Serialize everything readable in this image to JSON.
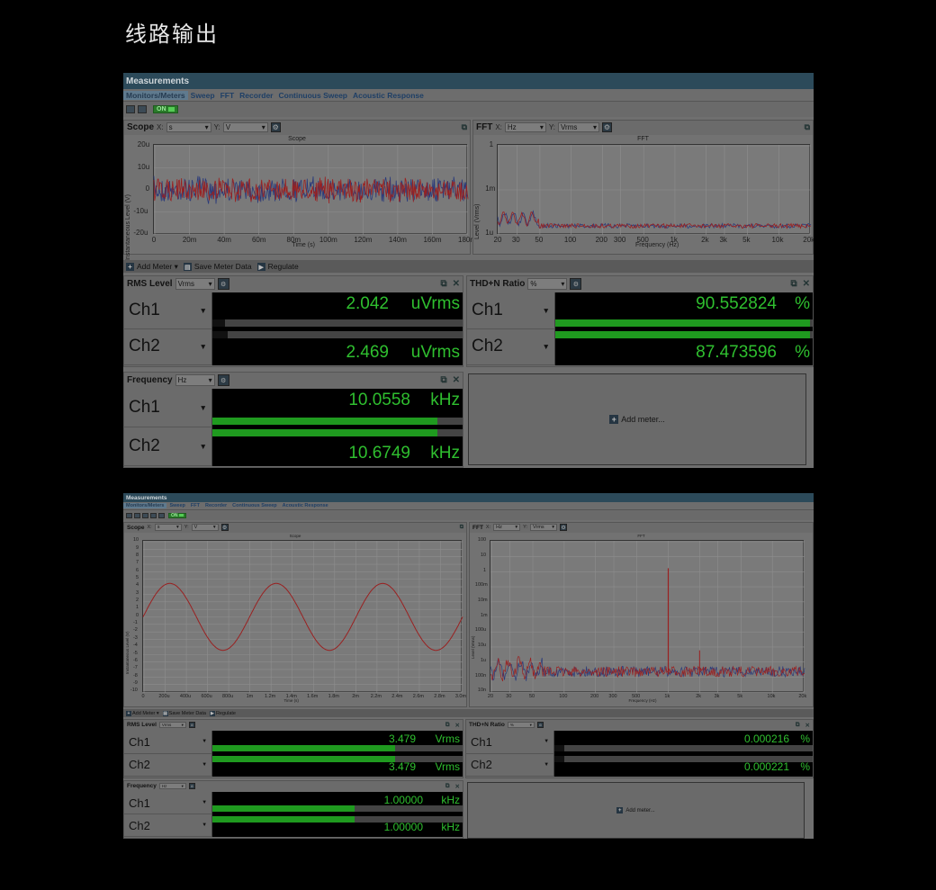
{
  "page_title": "线路输出",
  "window_title": "Measurements",
  "tabs": [
    "Monitors/Meters",
    "Sweep",
    "FFT",
    "Recorder",
    "Continuous Sweep",
    "Acoustic Response"
  ],
  "toolbar": {
    "on_label": "ON"
  },
  "meter_toolbar": {
    "add_meter": "Add Meter",
    "save_meter_data": "Save Meter Data",
    "regulate": "Regulate"
  },
  "add_meter_label": "Add meter...",
  "s1": {
    "scope": {
      "name": "Scope",
      "x_label": "X:",
      "x_unit": "s",
      "y_label": "Y:",
      "y_unit": "V",
      "plot_title": "Scope",
      "xticks": [
        "0",
        "20m",
        "40m",
        "60m",
        "80m",
        "100m",
        "120m",
        "140m",
        "160m",
        "180m"
      ],
      "yticks": [
        "20u",
        "10u",
        "0",
        "-10u",
        "-20u"
      ],
      "xlabel": "Time (s)",
      "ylabel": "Instantaneous Level (V)"
    },
    "fft": {
      "name": "FFT",
      "x_label": "X:",
      "x_unit": "Hz",
      "y_label": "Y:",
      "y_unit": "Vrms",
      "plot_title": "FFT",
      "xticks": [
        "20",
        "30",
        "50",
        "100",
        "200",
        "300",
        "500",
        "1k",
        "2k",
        "3k",
        "5k",
        "10k",
        "20k"
      ],
      "yticks": [
        "1",
        "1m",
        "1u"
      ],
      "xlabel": "Frequency (Hz)",
      "ylabel": "Level (Vrms)"
    },
    "rms": {
      "name": "RMS Level",
      "unit_sel": "Vrms",
      "ch1": {
        "name": "Ch1",
        "value": "2.042",
        "unit": "uVrms",
        "bar": 0.05
      },
      "ch2": {
        "name": "Ch2",
        "value": "2.469",
        "unit": "uVrms",
        "bar": 0.06
      }
    },
    "thdn": {
      "name": "THD+N Ratio",
      "unit_sel": "%",
      "ch1": {
        "name": "Ch1",
        "value": "90.552824",
        "unit": "%",
        "bar": 0.99
      },
      "ch2": {
        "name": "Ch2",
        "value": "87.473596",
        "unit": "%",
        "bar": 0.99
      }
    },
    "freq": {
      "name": "Frequency",
      "unit_sel": "Hz",
      "ch1": {
        "name": "Ch1",
        "value": "10.0558",
        "unit": "kHz",
        "bar": 0.9
      },
      "ch2": {
        "name": "Ch2",
        "value": "10.6749",
        "unit": "kHz",
        "bar": 0.9
      }
    }
  },
  "s2": {
    "scope": {
      "name": "Scope",
      "x_label": "X:",
      "x_unit": "s",
      "y_label": "Y:",
      "y_unit": "V",
      "plot_title": "Scope",
      "xticks": [
        "0",
        "200u",
        "400u",
        "600u",
        "800u",
        "1m",
        "1.2m",
        "1.4m",
        "1.6m",
        "1.8m",
        "2m",
        "2.2m",
        "2.4m",
        "2.6m",
        "2.8m",
        "3.0m"
      ],
      "yticks": [
        "10",
        "9",
        "8",
        "7",
        "6",
        "5",
        "4",
        "3",
        "2",
        "1",
        "0",
        "-1",
        "-2",
        "-3",
        "-4",
        "-5",
        "-6",
        "-7",
        "-8",
        "-9",
        "-10"
      ],
      "xlabel": "Time (s)",
      "ylabel": "Instantaneous Level (V)"
    },
    "fft": {
      "name": "FFT",
      "x_label": "X:",
      "x_unit": "Hz",
      "y_label": "Y:",
      "y_unit": "Vrms",
      "plot_title": "FFT",
      "xticks": [
        "20",
        "30",
        "50",
        "100",
        "200",
        "300",
        "500",
        "1k",
        "2k",
        "3k",
        "5k",
        "10k",
        "20k"
      ],
      "yticks": [
        "100",
        "10",
        "1",
        "100m",
        "10m",
        "1m",
        "100u",
        "10u",
        "1u",
        "100n",
        "10n"
      ],
      "xlabel": "Frequency (Hz)",
      "ylabel": "Level (Vrms)"
    },
    "rms": {
      "name": "RMS Level",
      "unit_sel": "Vrms",
      "ch1": {
        "name": "Ch1",
        "value": "3.479",
        "unit": "Vrms",
        "bar": 0.73
      },
      "ch2": {
        "name": "Ch2",
        "value": "3.479",
        "unit": "Vrms",
        "bar": 0.73
      }
    },
    "thdn": {
      "name": "THD+N Ratio",
      "unit_sel": "%",
      "ch1": {
        "name": "Ch1",
        "value": "0.000216",
        "unit": "%",
        "bar": 0.04
      },
      "ch2": {
        "name": "Ch2",
        "value": "0.000221",
        "unit": "%",
        "bar": 0.04
      }
    },
    "freq": {
      "name": "Frequency",
      "unit_sel": "Hz",
      "ch1": {
        "name": "Ch1",
        "value": "1.00000",
        "unit": "kHz",
        "bar": 0.57
      },
      "ch2": {
        "name": "Ch2",
        "value": "1.00000",
        "unit": "kHz",
        "bar": 0.57
      }
    }
  },
  "colors": {
    "meter_text": "#2fbf2f",
    "bar_fill": "#1f9a1f",
    "trace_red": "#9a2020",
    "trace_blue": "#2a3a7a"
  }
}
